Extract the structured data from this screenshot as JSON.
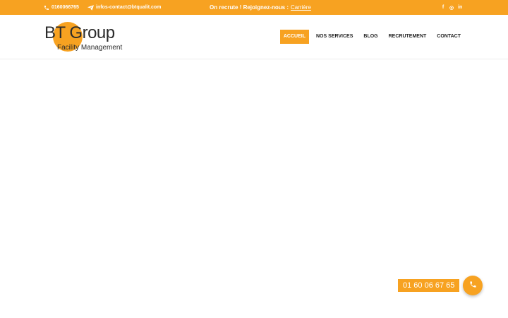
{
  "colors": {
    "accent": "#f7a221",
    "text_dark": "#222222",
    "background": "#ffffff"
  },
  "topbar": {
    "phone_icon": "phone-icon",
    "phone": "0160066765",
    "mail_icon": "paper-plane-icon",
    "email": "infos-contact@btqualit.com",
    "recruit_text": "On recrute ! Rejoignez-nous :",
    "recruit_link": "Carrière",
    "social": [
      {
        "icon": "facebook-icon",
        "label": "f"
      },
      {
        "icon": "instagram-icon",
        "label": "◎"
      },
      {
        "icon": "linkedin-icon",
        "label": "in"
      }
    ]
  },
  "logo": {
    "main": "BT Group",
    "sub": "Facility Management"
  },
  "nav": {
    "items": [
      {
        "label": "ACCUEIL",
        "active": true
      },
      {
        "label": "NOS SERVICES",
        "active": false
      },
      {
        "label": "BLOG",
        "active": false
      },
      {
        "label": "RECRUTEMENT",
        "active": false
      },
      {
        "label": "CONTACT",
        "active": false
      }
    ]
  },
  "call_widget": {
    "phone_display": "01 60 06 67 65",
    "icon": "phone-icon"
  }
}
